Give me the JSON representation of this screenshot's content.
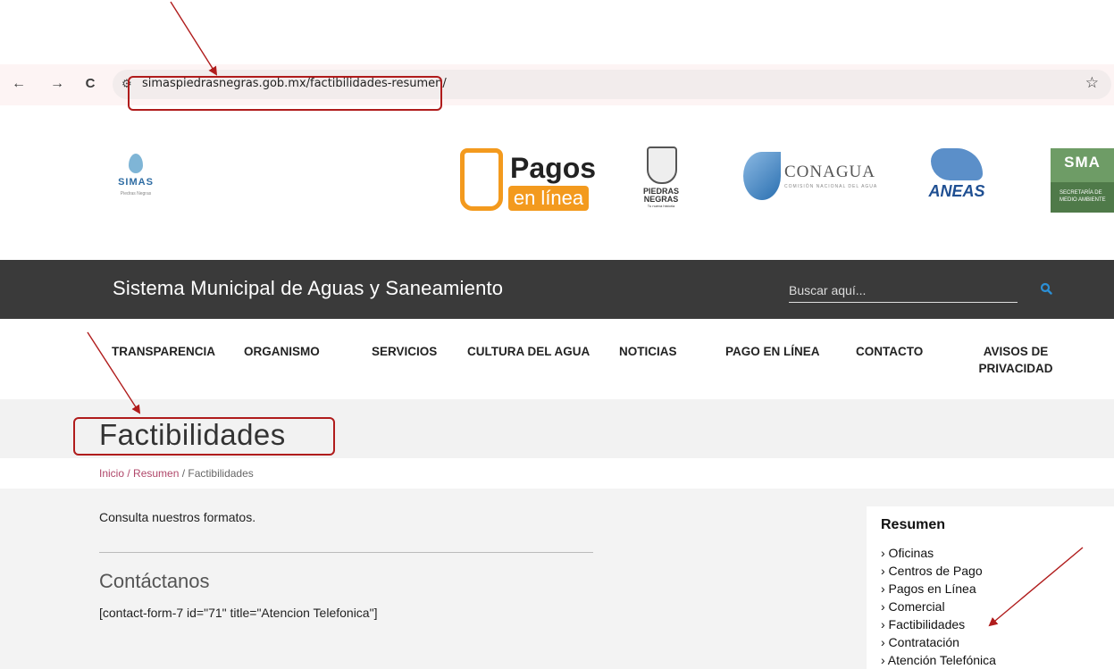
{
  "browser": {
    "back_icon": "←",
    "forward_icon": "→",
    "reload_icon": "C",
    "site_settings_icon": "⚙",
    "url": "simaspiedrasnegras.gob.mx/factibilidades-resumen/",
    "bookmark_icon": "☆"
  },
  "logos": {
    "simas": {
      "text": "SIMAS",
      "sub": "Piedras Negras"
    },
    "pagos": {
      "title": "Pagos",
      "sub": "en línea"
    },
    "piedras_negras": {
      "line1": "PIEDRAS",
      "line2": "NEGRAS",
      "line3": "Tu nueva historia"
    },
    "conagua": {
      "text": "CONAGUA",
      "sub": "COMISIÓN NACIONAL DEL AGUA"
    },
    "aneas": {
      "text": "ANEAS"
    },
    "sma": {
      "text": "SMA",
      "sub": "SECRETARÍA DE MEDIO AMBIENTE"
    }
  },
  "header": {
    "site_title": "Sistema Municipal de Aguas y Saneamiento",
    "search_placeholder": "Buscar aquí..."
  },
  "nav": {
    "items": [
      {
        "label": "TRANSPARENCIA"
      },
      {
        "label": "ORGANISMO"
      },
      {
        "label": "SERVICIOS"
      },
      {
        "label": "CULTURA DEL AGUA"
      },
      {
        "label": "NOTICIAS"
      },
      {
        "label": "PAGO EN LÍNEA"
      },
      {
        "label": "CONTACTO"
      },
      {
        "label": "AVISOS DE PRIVACIDAD"
      }
    ]
  },
  "page": {
    "title": "Factibilidades",
    "breadcrumb": {
      "home": "Inicio",
      "sep1": " / ",
      "parent": "Resumen",
      "sep2": " / ",
      "current": "Factibilidades"
    },
    "intro": "Consulta nuestros formatos.",
    "contact_heading": "Contáctanos",
    "shortcode": "[contact-form-7 id=\"71\" title=\"Atencion Telefonica\"]"
  },
  "sidebar": {
    "title": "Resumen",
    "items": [
      {
        "label": "› Oficinas"
      },
      {
        "label": "› Centros de Pago"
      },
      {
        "label": "› Pagos en Línea"
      },
      {
        "label": "› Comercial"
      },
      {
        "label": "› Factibilidades"
      },
      {
        "label": "› Contratación"
      },
      {
        "label": "› Atención Telefónica"
      }
    ]
  },
  "colors": {
    "annotation": "#b01c1c",
    "header_band": "#3a3a3a",
    "link": "#b0476a",
    "search_icon": "#2b8fd6"
  }
}
